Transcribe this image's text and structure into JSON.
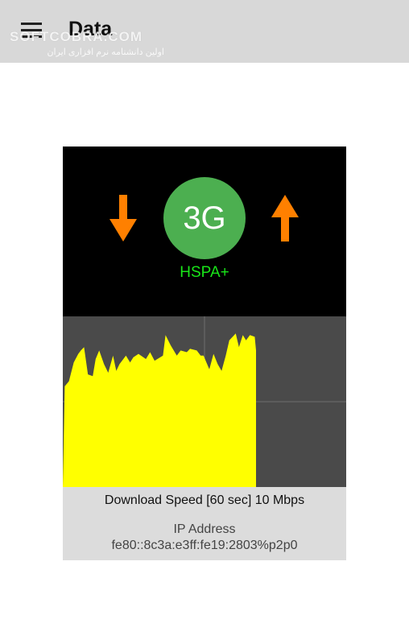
{
  "appbar": {
    "title": "Data",
    "watermark": "SOFTCOBRA.COM",
    "watermark_sub": "اولین دانشنامه نرم افزاری ایران"
  },
  "network": {
    "type": "3G",
    "subtype": "HSPA+",
    "icons": {
      "download": "arrow-down-icon",
      "upload": "arrow-up-icon",
      "menu": "hamburger-menu-icon"
    },
    "colors": {
      "arrow": "#ff8000",
      "circle": "#4caf50",
      "subtype": "#19e619",
      "graph_fill": "#ffff00",
      "graph_bg": "#4a4a4a"
    }
  },
  "info": {
    "speed": "Download Speed [60 sec] 10 Mbps",
    "ip_label": "IP Address",
    "ip_value": "fe80::8c3a:e3ff:fe19:2803%p2p0"
  },
  "chart_data": {
    "type": "area",
    "title": "",
    "xlabel": "",
    "ylabel": "",
    "xlim": [
      0,
      60
    ],
    "ylim": [
      0,
      100
    ],
    "grid": true,
    "series": [
      {
        "values": [
          [
            0,
            0
          ],
          [
            0.6,
            59
          ],
          [
            1.9,
            62
          ],
          [
            3.4,
            73
          ],
          [
            4.8,
            78
          ],
          [
            5.6,
            80
          ],
          [
            6.6,
            82
          ],
          [
            7.8,
            66
          ],
          [
            9.3,
            65
          ],
          [
            10.2,
            75
          ],
          [
            11.3,
            80
          ],
          [
            12.8,
            72
          ],
          [
            14.1,
            67
          ],
          [
            15.6,
            77
          ],
          [
            16.6,
            68
          ],
          [
            17.6,
            72
          ],
          [
            19.6,
            77
          ],
          [
            20.9,
            73
          ],
          [
            21.9,
            76
          ],
          [
            23.5,
            78
          ],
          [
            25.8,
            75
          ],
          [
            27.1,
            79
          ],
          [
            28.5,
            74
          ],
          [
            31.1,
            77
          ],
          [
            31.9,
            89
          ],
          [
            33.5,
            83
          ],
          [
            35.4,
            77
          ],
          [
            36.6,
            80
          ],
          [
            38.5,
            79
          ],
          [
            39.5,
            81
          ],
          [
            41.6,
            80
          ],
          [
            42.8,
            77
          ],
          [
            43.7,
            77
          ],
          [
            45.5,
            69
          ],
          [
            46.8,
            78
          ],
          [
            48.1,
            72
          ],
          [
            49.3,
            68
          ],
          [
            50.6,
            77
          ],
          [
            51.7,
            86
          ],
          [
            53.7,
            90
          ],
          [
            54.7,
            82
          ],
          [
            55.9,
            89
          ],
          [
            56.9,
            86
          ],
          [
            58.1,
            89
          ],
          [
            59.6,
            88
          ],
          [
            60,
            80
          ],
          [
            60,
            0
          ]
        ]
      }
    ]
  }
}
